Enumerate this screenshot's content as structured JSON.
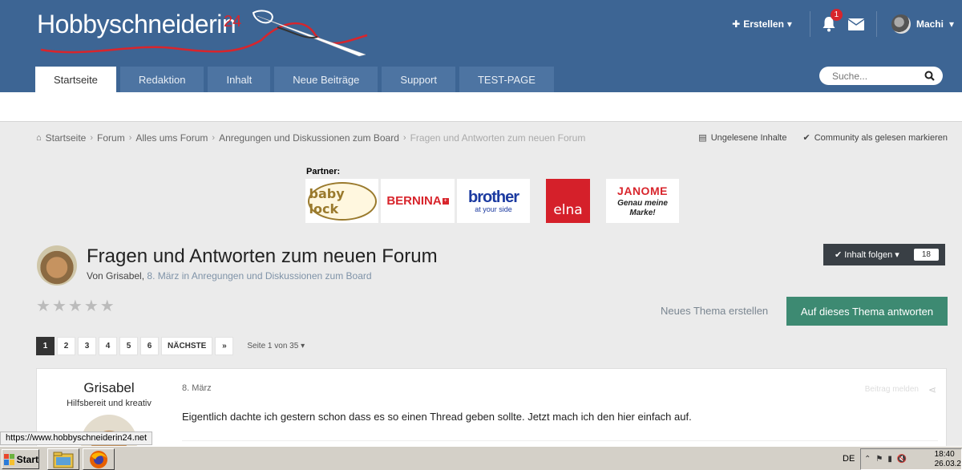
{
  "header": {
    "logo_text": "Hobbyschneiderin",
    "logo_suffix": "24",
    "create_label": "Erstellen",
    "notification_count": "1",
    "username": "Machi"
  },
  "nav": {
    "tabs": [
      {
        "label": "Startseite",
        "active": true
      },
      {
        "label": "Redaktion"
      },
      {
        "label": "Inhalt"
      },
      {
        "label": "Neue Beiträge"
      },
      {
        "label": "Support"
      },
      {
        "label": "TEST-PAGE"
      }
    ],
    "search_placeholder": "Suche..."
  },
  "breadcrumb": {
    "items": [
      "Startseite",
      "Forum",
      "Alles ums Forum",
      "Anregungen und Diskussionen zum Board",
      "Fragen und Antworten zum neuen Forum"
    ],
    "unread": "Ungelesene Inhalte",
    "mark_read": "Community als gelesen markieren"
  },
  "partners": {
    "label": "Partner:",
    "logos": [
      "baby lock",
      "BERNINA",
      "brother",
      "at your side",
      "elna",
      "JANOME",
      "Genau meine Marke!"
    ]
  },
  "topic": {
    "title": "Fragen und Antworten zum neuen Forum",
    "by": "Von Grisabel,",
    "meta": "8. März in Anregungen und Diskussionen zum Board",
    "follow_label": "Inhalt folgen",
    "follow_count": "18",
    "new_topic": "Neues Thema erstellen",
    "reply": "Auf dieses Thema antworten"
  },
  "pagination": {
    "pages": [
      "1",
      "2",
      "3",
      "4",
      "5",
      "6"
    ],
    "next": "NÄCHSTE",
    "last": "»",
    "info": "Seite 1 von 35"
  },
  "post": {
    "author": "Grisabel",
    "rank": "Hilfsbereit und kreativ",
    "date": "8. März",
    "report": "Beitrag melden",
    "text": "Eigentlich dachte ich gestern schon dass es so einen Thread geben sollte. Jetzt mach ich den  hier einfach auf."
  },
  "statusbar": {
    "url": "https://www.hobbyschneiderin24.net"
  },
  "taskbar": {
    "start": "Start",
    "lang": "DE",
    "time": "18:40",
    "date": "26.03.2"
  }
}
